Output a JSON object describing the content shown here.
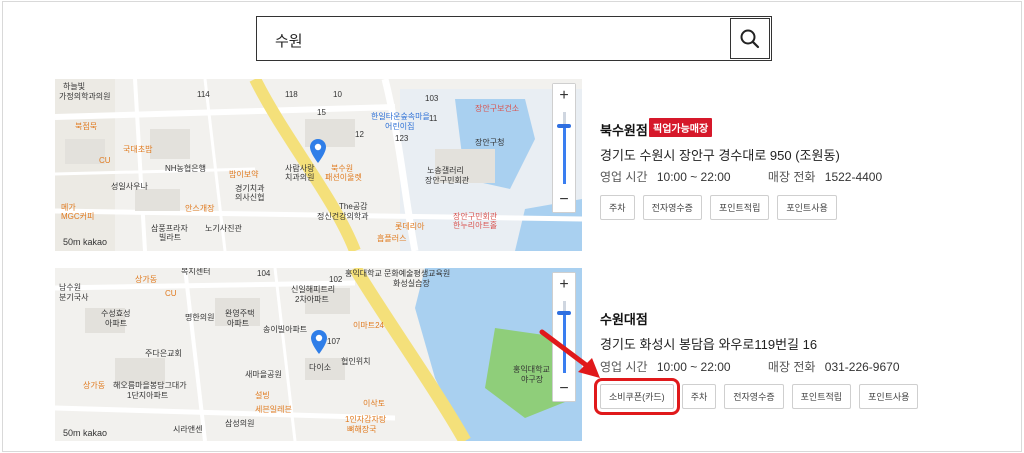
{
  "search": {
    "query": "수원"
  },
  "stores": [
    {
      "name": "북수원점",
      "badge": "픽업가능매장",
      "address": "경기도 수원시 장안구 경수대로 950 (조원동)",
      "hours_label": "영업 시간",
      "hours": "10:00 ~ 22:00",
      "phone_label": "매장 전화",
      "phone": "1522-4400",
      "tags": [
        "주차",
        "전자영수증",
        "포인트적립",
        "포인트사용"
      ]
    },
    {
      "name": "수원대점",
      "address": "경기도 화성시 봉담읍 와우로119번길 16",
      "hours_label": "영업 시간",
      "hours": "10:00 ~ 22:00",
      "phone_label": "매장 전화",
      "phone": "031-226-9670",
      "tags": [
        "소비쿠폰(카드)",
        "주차",
        "전자영수증",
        "포인트적립",
        "포인트사용"
      ]
    }
  ],
  "map1": {
    "scale": "50m",
    "brand": "kakao",
    "labels": [
      "하늘빛",
      "가정의학과의원",
      "북점묵",
      "CU",
      "국대초밥",
      "NH농협은행",
      "밥이보약",
      "성일사우나",
      "경기치과",
      "의사신협",
      "메가",
      "MGC커피",
      "안스개장",
      "삼풍프라자",
      "빌라트",
      "노기사진관",
      "사람사랑",
      "치과의원",
      "북수원",
      "패션이울렛",
      "The공감",
      "정신건강의학과",
      "한일타운숲속마을",
      "어린이집",
      "장안구보건소",
      "장안구청",
      "노송갤러리",
      "장안구민회관",
      "장안구민회관",
      "한누리아트홀",
      "롯데리아",
      "흡플러스",
      "114",
      "118",
      "10",
      "15",
      "12",
      "123",
      "103",
      "11"
    ]
  },
  "map2": {
    "scale": "50m",
    "brand": "kakao",
    "labels": [
      "남수원",
      "분기국사",
      "상가동",
      "CU",
      "복지센터",
      "완영주택",
      "아파트",
      "신일해피트리",
      "2차아파트",
      "수성효성",
      "아파트",
      "명한의원",
      "송이빌아파트",
      "이마트24",
      "주다은교회",
      "다이소",
      "협인위치",
      "새마을공원",
      "해오름마을봉담그대가",
      "1단지아파트",
      "상가동",
      "설빙",
      "세븐일레븐",
      "이삭토",
      "1인자감자탕",
      "뼈해장국",
      "삼성의원",
      "시라앤센",
      "홍익대학교 문화예술평생교육원",
      "화성실습장",
      "홍익대학교",
      "야구장",
      "104",
      "102",
      "107"
    ]
  },
  "colors": {
    "accent": "#d6182a",
    "highlight": "#e0191b",
    "pin": "#2f7ee8"
  }
}
